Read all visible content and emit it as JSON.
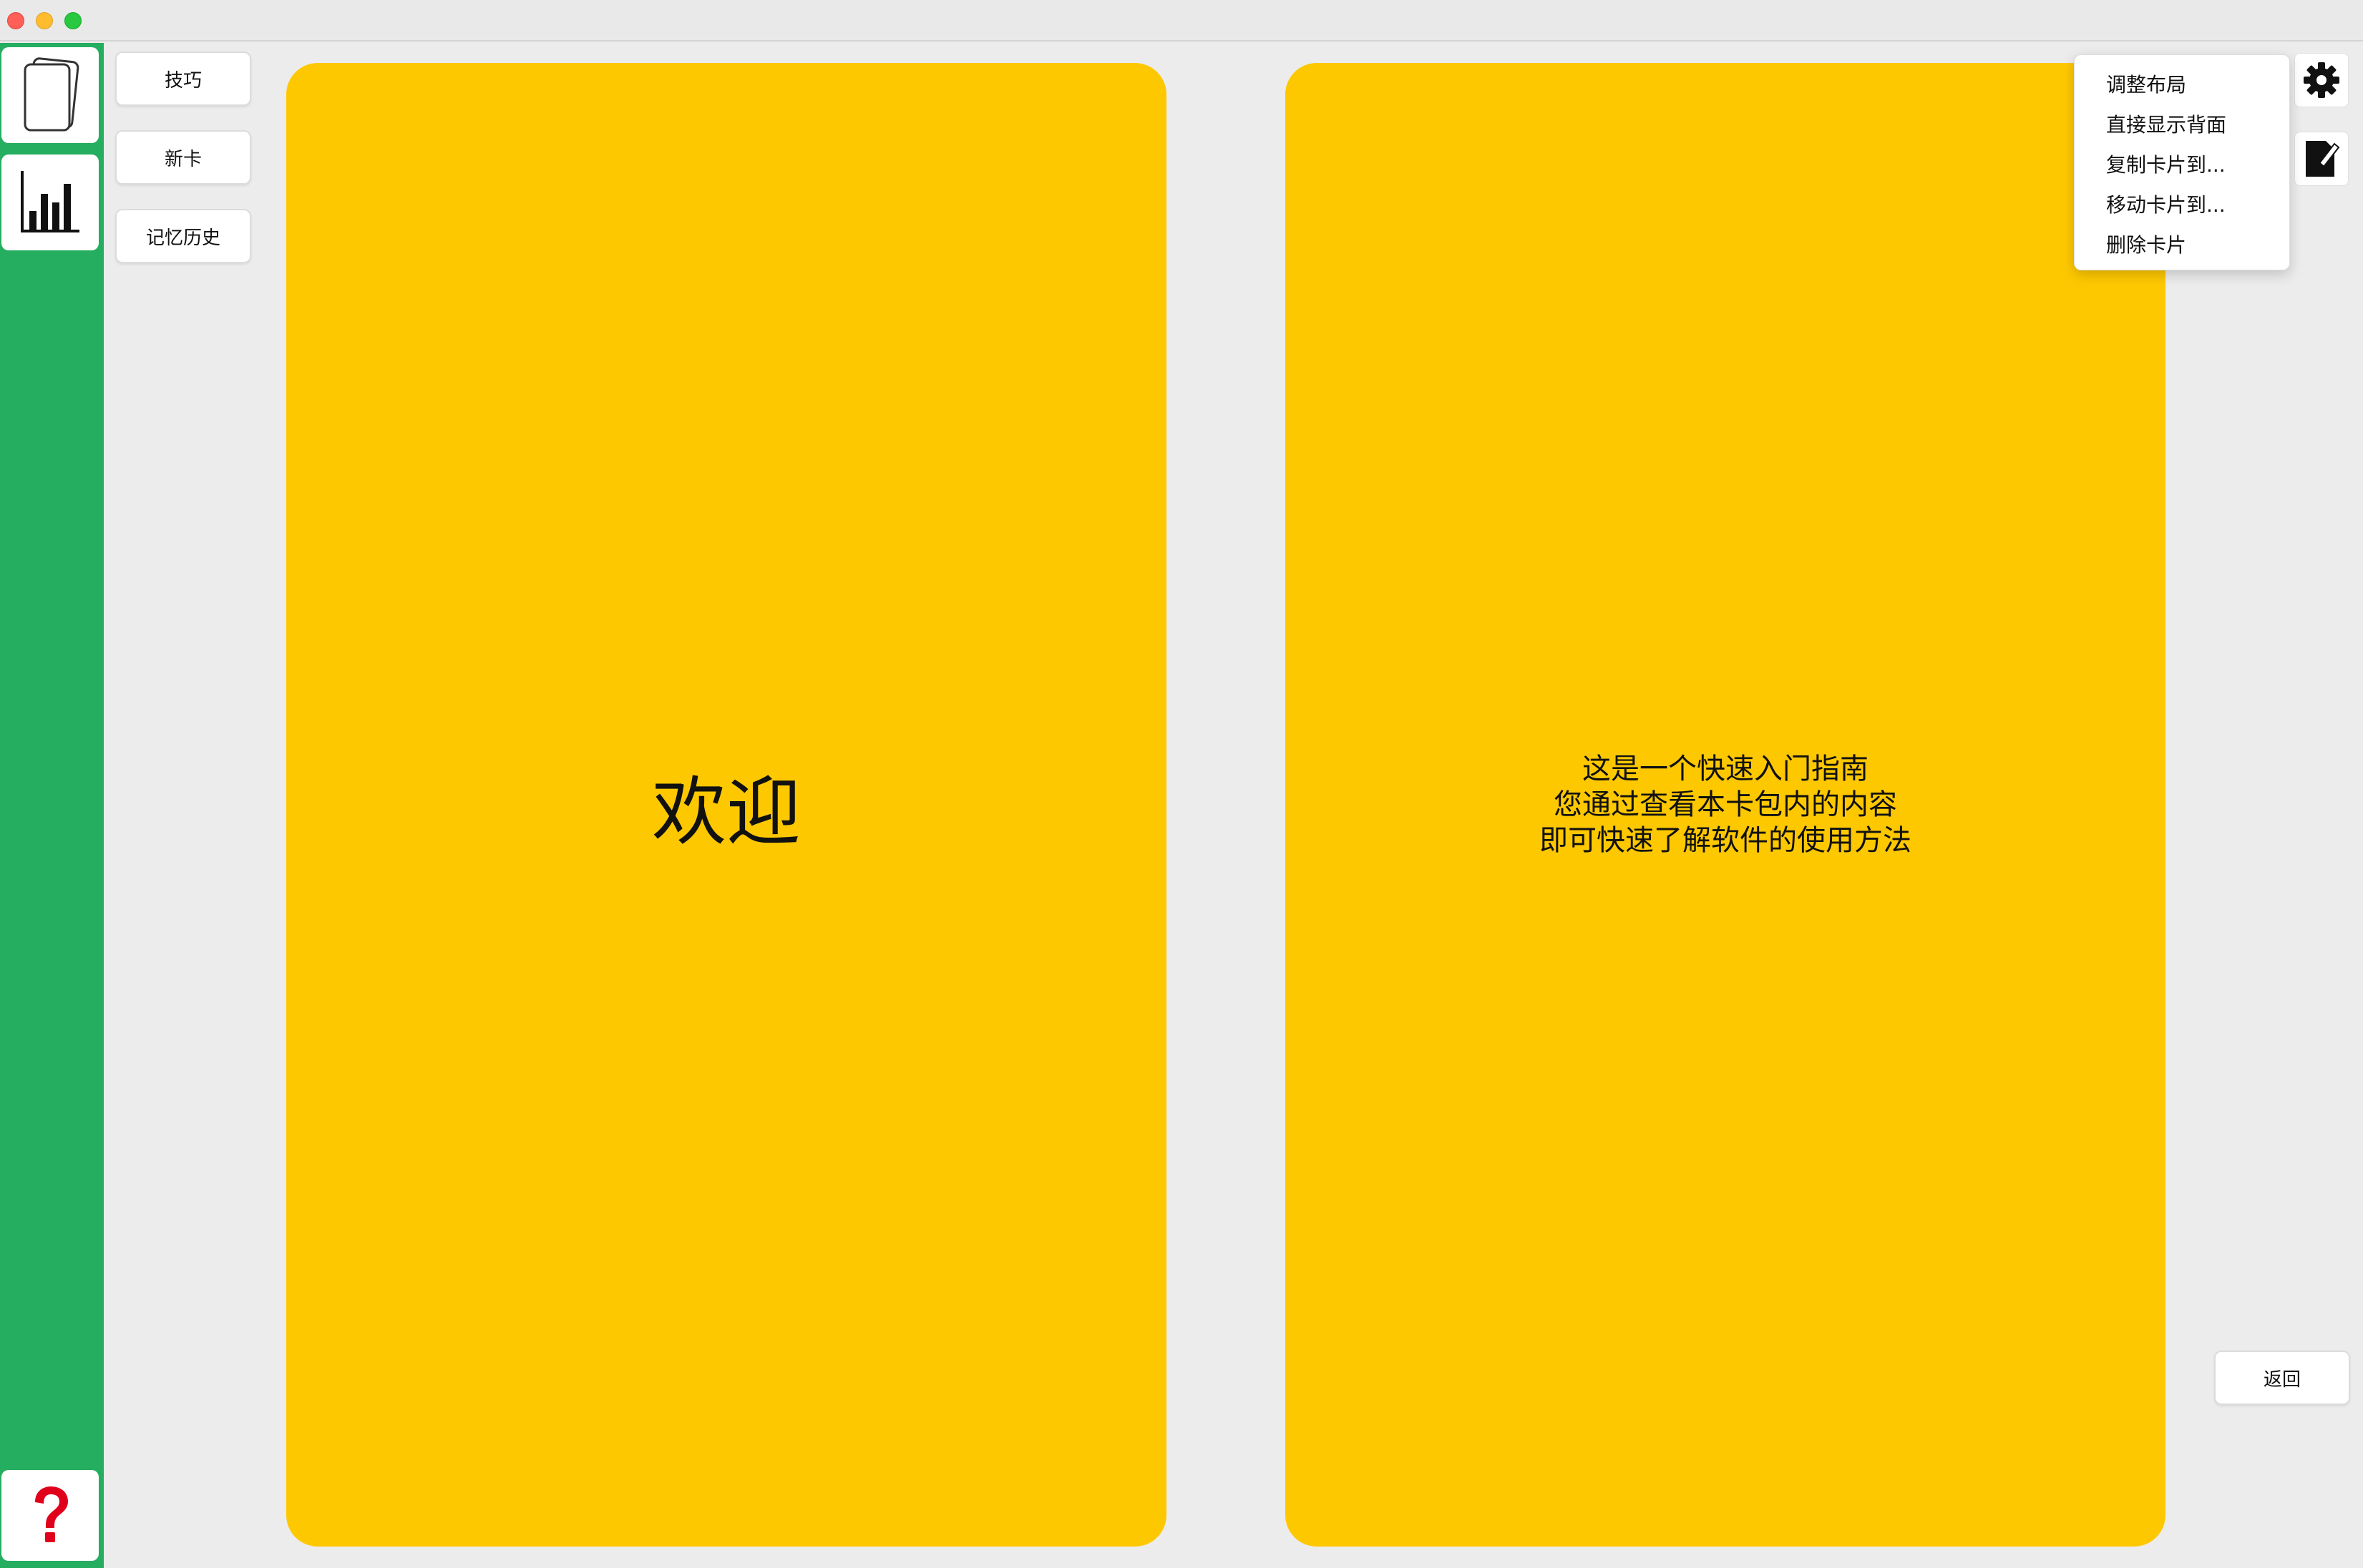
{
  "window": {
    "traffic_lights": [
      "close",
      "minimize",
      "maximize"
    ]
  },
  "rail": {
    "background": "#25ae5f",
    "items": [
      {
        "icon": "cards-icon"
      },
      {
        "icon": "bar-chart-icon"
      },
      {
        "icon": "question-mark-icon"
      }
    ]
  },
  "nav": {
    "tips_label": "技巧",
    "new_card_label": "新卡",
    "history_label": "记忆历史"
  },
  "card": {
    "color": "#fec800",
    "front_text": "欢迎",
    "back_lines": [
      "这是一个快速入门指南",
      "您通过查看本卡包内的内容",
      "即可快速了解软件的使用方法"
    ]
  },
  "tools": {
    "settings_icon": "gear-icon",
    "edit_icon": "edit-note-icon"
  },
  "menu": {
    "items": [
      "调整布局",
      "直接显示背面",
      "复制卡片到...",
      "移动卡片到...",
      "删除卡片"
    ]
  },
  "back_button_label": "返回"
}
